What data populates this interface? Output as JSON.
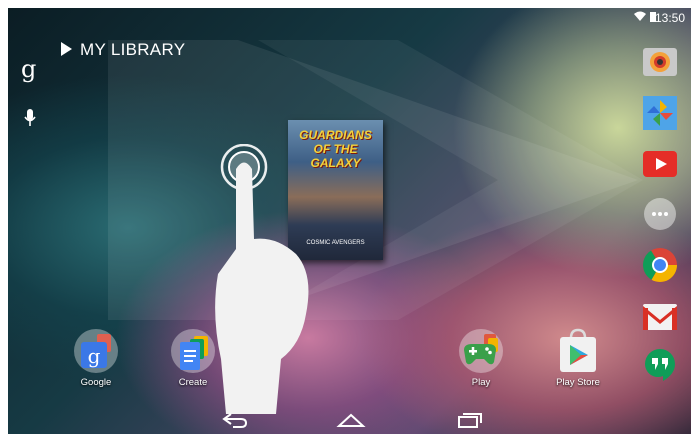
{
  "status_bar": {
    "time": "13:50",
    "icons": [
      "wifi-icon",
      "battery-icon"
    ]
  },
  "search": {
    "google_glyph": "g",
    "voice_icon": "mic-icon"
  },
  "widget": {
    "title": "MY LIBRARY",
    "book": {
      "title": "GUARDIANS OF THE GALAXY",
      "subtitle": "COSMIC AVENGERS"
    }
  },
  "home_apps": [
    {
      "label": "Google"
    },
    {
      "label": "Create"
    },
    {
      "label": "Play"
    },
    {
      "label": "Play Store"
    }
  ],
  "dock": [
    "camera-icon",
    "photos-icon",
    "youtube-icon",
    "app-drawer-icon",
    "chrome-icon",
    "gmail-icon",
    "hangouts-icon"
  ],
  "nav": {
    "back": "back-icon",
    "home": "home-icon",
    "recents": "recents-icon"
  }
}
